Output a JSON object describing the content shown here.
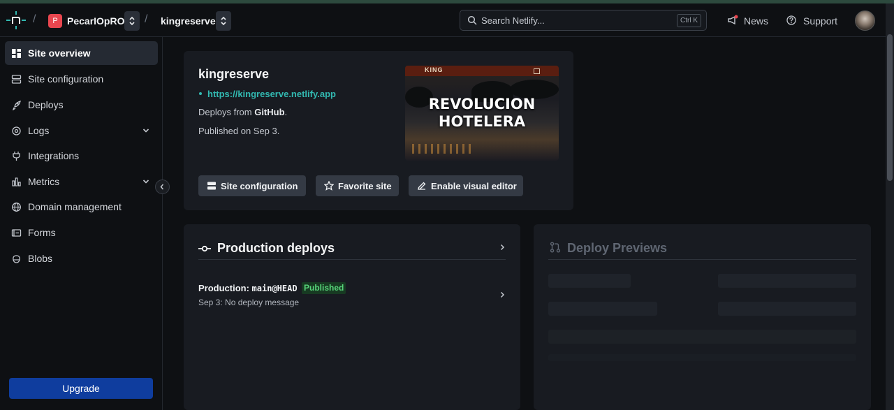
{
  "header": {
    "team_initial": "P",
    "team_name": "PecarIOpRO",
    "site_name": "kingreserve",
    "search_placeholder": "Search Netlify...",
    "search_shortcut": "Ctrl K",
    "news_label": "News",
    "support_label": "Support",
    "separator": "/"
  },
  "sidebar": {
    "items": [
      {
        "label": "Site overview",
        "icon": "grid-icon"
      },
      {
        "label": "Site configuration",
        "icon": "server-icon"
      },
      {
        "label": "Deploys",
        "icon": "rocket-icon"
      },
      {
        "label": "Logs",
        "icon": "logs-icon"
      },
      {
        "label": "Integrations",
        "icon": "plug-icon"
      },
      {
        "label": "Metrics",
        "icon": "bar-chart-icon"
      },
      {
        "label": "Domain management",
        "icon": "globe-icon"
      },
      {
        "label": "Forms",
        "icon": "form-icon"
      },
      {
        "label": "Blobs",
        "icon": "blobs-icon"
      }
    ],
    "upgrade_label": "Upgrade"
  },
  "site_card": {
    "title": "kingreserve",
    "url": "https://kingreserve.netlify.app",
    "deploys_from_prefix": "Deploys from ",
    "deploys_from_source": "GitHub",
    "deploys_from_suffix": ".",
    "published": "Published on Sep 3.",
    "preview_logo": "KING",
    "preview_heading_line1": "REVOLUCION",
    "preview_heading_line2": "HOTELERA",
    "buttons": {
      "site_configuration": "Site configuration",
      "favorite": "Favorite site",
      "visual_editor": "Enable visual editor"
    }
  },
  "production_deploys": {
    "title": "Production deploys",
    "deploy": {
      "prefix": "Production: ",
      "ref": "main@HEAD",
      "status": "Published",
      "subtitle": "Sep 3: No deploy message"
    }
  },
  "deploy_previews": {
    "title": "Deploy Previews"
  },
  "colors": {
    "accent_teal": "#32b9b1",
    "upgrade_blue": "#0f3d9e",
    "published_green": "#58d47a",
    "team_red": "#e9464f"
  }
}
